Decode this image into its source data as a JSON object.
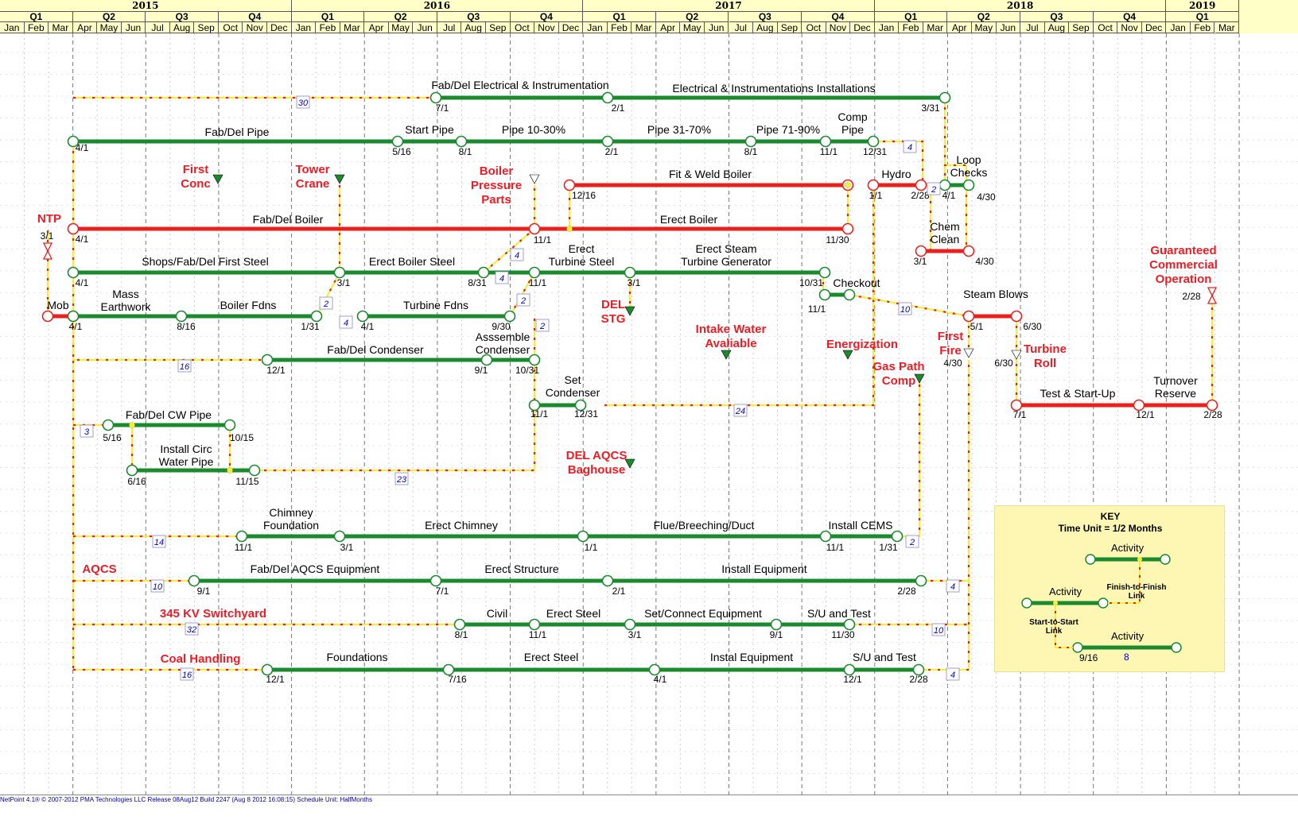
{
  "timescale": {
    "years": [
      {
        "label": "2015",
        "months": 12
      },
      {
        "label": "2016",
        "months": 12
      },
      {
        "label": "2017",
        "months": 12
      },
      {
        "label": "2018",
        "months": 12
      },
      {
        "label": "2019",
        "months": 3
      }
    ],
    "quarters": [
      "Q1",
      "Q2",
      "Q3",
      "Q4",
      "Q1",
      "Q2",
      "Q3",
      "Q4",
      "Q1",
      "Q2",
      "Q3",
      "Q4",
      "Q1",
      "Q2",
      "Q3",
      "Q4",
      "Q1"
    ],
    "months": [
      "Jan",
      "Feb",
      "Mar",
      "Apr",
      "May",
      "Jun",
      "Jul",
      "Aug",
      "Sep",
      "Oct",
      "Nov",
      "Dec",
      "Jan",
      "Feb",
      "Mar",
      "Apr",
      "May",
      "Jun",
      "Jul",
      "Aug",
      "Sep",
      "Oct",
      "Nov",
      "Dec",
      "Jan",
      "Feb",
      "Mar",
      "Apr",
      "May",
      "Jun",
      "Jul",
      "Aug",
      "Sep",
      "Oct",
      "Nov",
      "Dec",
      "Jan",
      "Feb",
      "Mar",
      "Apr",
      "May",
      "Jun",
      "Jul",
      "Aug",
      "Sep",
      "Oct",
      "Nov",
      "Dec",
      "Jan",
      "Feb",
      "Mar"
    ]
  },
  "colors": {
    "critical": "#e8201e",
    "noncritical": "#1b8a2e",
    "link": "#f2ee3a",
    "link_dash": "#e8201e",
    "milestone": "#ee1c24",
    "lag": "#0000cc"
  },
  "activities": [
    {
      "label": "Fab/Del Electrical & Instrumentation",
      "crit": false
    },
    {
      "label": "Electrical & Instrumentations Installations",
      "crit": false
    },
    {
      "label": "Fab/Del Pipe",
      "crit": false
    },
    {
      "label": "Start Pipe",
      "crit": false
    },
    {
      "label": "Pipe 10-30%",
      "crit": false
    },
    {
      "label": "Pipe 31-70%",
      "crit": false
    },
    {
      "label": "Pipe 71-90%",
      "crit": false
    },
    {
      "label": "Comp Pipe",
      "crit": false
    },
    {
      "label": "Fit & Weld Boiler",
      "crit": true
    },
    {
      "label": "Hydro",
      "crit": true
    },
    {
      "label": "Loop Checks",
      "crit": false
    },
    {
      "label": "Fab/Del Boiler",
      "crit": true
    },
    {
      "label": "Erect Boiler",
      "crit": true
    },
    {
      "label": "Chem Clean",
      "crit": true
    },
    {
      "label": "Shops/Fab/Del First Steel",
      "crit": false
    },
    {
      "label": "Erect Boiler Steel",
      "crit": false
    },
    {
      "label": "Erect Turbine Steel",
      "crit": false
    },
    {
      "label": "Erect Steam Turbine Generator",
      "crit": false
    },
    {
      "label": "Checkout",
      "crit": false
    },
    {
      "label": "Mob",
      "crit": true
    },
    {
      "label": "Mass Earthwork",
      "crit": false
    },
    {
      "label": "Boiler Fdns",
      "crit": false
    },
    {
      "label": "Turbine Fdns",
      "crit": false
    },
    {
      "label": "Steam Blows",
      "crit": true
    },
    {
      "label": "Fab/Del Condenser",
      "crit": false
    },
    {
      "label": "Asssemble Condenser",
      "crit": false
    },
    {
      "label": "Set Condenser",
      "crit": false
    },
    {
      "label": "Fab/Del CW Pipe",
      "crit": false
    },
    {
      "label": "Install Circ Water Pipe",
      "crit": false
    },
    {
      "label": "Test & Start-Up",
      "crit": true
    },
    {
      "label": "Turnover Reserve",
      "crit": true
    },
    {
      "label": "Chimney Foundation",
      "crit": false
    },
    {
      "label": "Erect Chimney",
      "crit": false
    },
    {
      "label": "Flue/Breeching/Duct",
      "crit": false
    },
    {
      "label": "Install CEMS",
      "crit": false
    },
    {
      "label": "Fab/Del AQCS Equipment",
      "crit": false
    },
    {
      "label": "Erect Structure",
      "crit": false
    },
    {
      "label": "Install Equipment",
      "crit": false
    },
    {
      "label": "Civil",
      "crit": false
    },
    {
      "label": "Erect Steel",
      "crit": false
    },
    {
      "label": "Set/Connect Equipment",
      "crit": false
    },
    {
      "label": "S/U and Test",
      "crit": false
    },
    {
      "label": "Foundations",
      "crit": false
    },
    {
      "label": "Erect Steel",
      "crit": false
    },
    {
      "label": "Instal Equipment",
      "crit": false
    },
    {
      "label": "S/U and Test",
      "crit": false
    }
  ],
  "milestones": [
    {
      "label": "NTP"
    },
    {
      "label": "First Conc"
    },
    {
      "label": "Tower Crane"
    },
    {
      "label": "Boiler Pressure Parts"
    },
    {
      "label": "DEL STG"
    },
    {
      "label": "Intake Water Avaliable"
    },
    {
      "label": "Energization"
    },
    {
      "label": "Gas Path Comp"
    },
    {
      "label": "First Fire"
    },
    {
      "label": "Turbine Roll"
    },
    {
      "label": "DEL AQCS Baghouse"
    },
    {
      "label": "Guaranteed Commercial Operation"
    },
    {
      "label": "AQCS"
    },
    {
      "label": "345 KV Switchyard"
    },
    {
      "label": "Coal Handling"
    }
  ],
  "dates": [
    "7/1",
    "2/1",
    "3/31",
    "4/1",
    "5/16",
    "8/1",
    "2/1",
    "8/1",
    "11/1",
    "12/31",
    "12/16",
    "1/1",
    "2/28",
    "4/1",
    "4/30",
    "3/1",
    "4/1",
    "11/1",
    "11/30",
    "3/1",
    "4/30",
    "4/1",
    "3/1",
    "8/31",
    "11/1",
    "3/1",
    "10/31",
    "11/1",
    "4/1",
    "8/16",
    "1/31",
    "4/1",
    "9/30",
    "5/1",
    "6/30",
    "4/30",
    "6/30",
    "12/1",
    "9/1",
    "10/31",
    "11/1",
    "12/31",
    "5/16",
    "10/15",
    "6/16",
    "11/15",
    "7/1",
    "12/1",
    "2/28",
    "2/28",
    "11/1",
    "3/1",
    "1/1",
    "11/1",
    "1/31",
    "9/1",
    "7/1",
    "2/1",
    "2/28",
    "8/1",
    "11/1",
    "3/1",
    "9/1",
    "11/30",
    "12/1",
    "7/16",
    "4/1",
    "12/1",
    "2/28"
  ],
  "lags": [
    "30",
    "4",
    "2",
    "4",
    "4",
    "4",
    "2",
    "2",
    "2",
    "10",
    "16",
    "24",
    "3",
    "23",
    "14",
    "2",
    "10",
    "4",
    "32",
    "10",
    "16",
    "4"
  ],
  "key": {
    "title_line1": "KEY",
    "title_line2": "Time Unit = 1/2 Months",
    "activity1": "Activity",
    "activity2": "Activity",
    "activity3": "Activity",
    "ff_link": "Finish-to-Finish Link",
    "ss_link": "Start-to-Start Link",
    "date": "9/16",
    "lag": "8"
  },
  "footer": "NetPoint 4.1® © 2007-2012 PMA Technologies LLC   Release 08Aug12 Build 2247   (Aug  8 2012  16:08:15)   Schedule Unit: HalfMonths"
}
